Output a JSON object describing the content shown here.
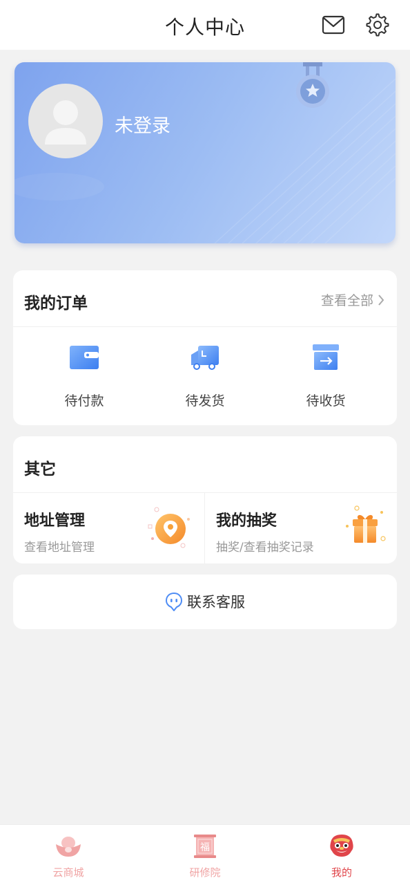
{
  "header": {
    "title": "个人中心",
    "mail_icon": "mail-icon",
    "settings_icon": "gear-icon"
  },
  "profile": {
    "login_status": "未登录",
    "avatar_icon": "avatar-placeholder-icon",
    "medal_icon": "medal-icon"
  },
  "orders": {
    "title": "我的订单",
    "view_all": "查看全部",
    "items": [
      {
        "label": "待付款",
        "icon": "wallet-icon"
      },
      {
        "label": "待发货",
        "icon": "truck-icon"
      },
      {
        "label": "待收货",
        "icon": "box-icon"
      }
    ]
  },
  "others": {
    "title": "其它",
    "tiles": [
      {
        "title": "地址管理",
        "subtitle": "查看地址管理",
        "icon": "location-icon"
      },
      {
        "title": "我的抽奖",
        "subtitle": "抽奖/查看抽奖记录",
        "icon": "gift-icon"
      }
    ]
  },
  "service": {
    "label": "联系客服",
    "icon": "chat-icon"
  },
  "tabbar": {
    "items": [
      {
        "label": "云商城",
        "icon": "ingot-icon",
        "color": "#f0a4a4"
      },
      {
        "label": "研修院",
        "icon": "fu-scroll-icon",
        "color": "#f0a4a4"
      },
      {
        "label": "我的",
        "icon": "lion-icon",
        "color": "#e0454a"
      }
    ]
  },
  "colors": {
    "accent_blue": "#4f8df5",
    "card_blue": "#8fb2f0",
    "active_tab": "#e0454a",
    "inactive_tab": "#f0a4a4",
    "orange": "#f7a13a"
  }
}
